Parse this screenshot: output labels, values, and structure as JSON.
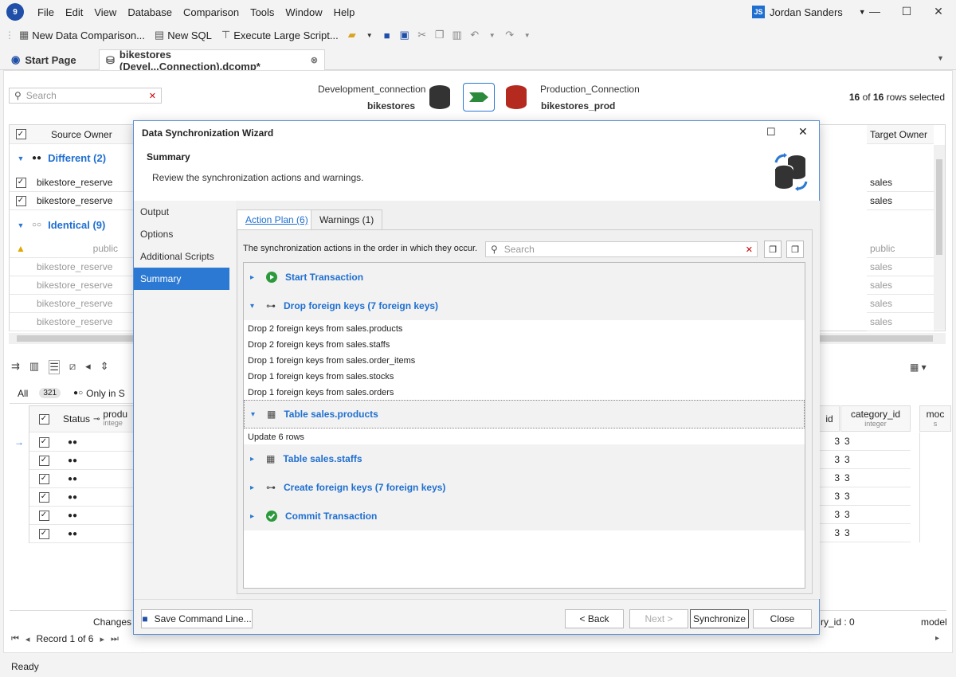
{
  "menu": [
    "File",
    "Edit",
    "View",
    "Database",
    "Comparison",
    "Tools",
    "Window",
    "Help"
  ],
  "user": {
    "initials": "JS",
    "name": "Jordan Sanders"
  },
  "toolbar": {
    "new_data_comparison": "New Data Comparison...",
    "new_sql": "New SQL",
    "execute_large_script": "Execute Large Script..."
  },
  "tabs": {
    "start_page": "Start Page",
    "document": "bikestores (Devel...Connection).dcomp*"
  },
  "main": {
    "search_placeholder": "Search",
    "source_conn_label": "Development_connection",
    "source_db": "bikestores",
    "target_conn_label": "Production_Connection",
    "target_db": "bikestores_prod",
    "rows_selected_a": "16",
    "rows_selected_of": "of",
    "rows_selected_b": "16",
    "rows_selected_suffix": "rows selected",
    "col_source_owner": "Source Owner",
    "col_target_owner": "Target Owner",
    "group_different": "Different (2)",
    "group_identical": "Identical (9)",
    "rows_left": [
      "bikestore_reserve",
      "bikestore_reserve",
      "public",
      "bikestore_reserve",
      "bikestore_reserve",
      "bikestore_reserve",
      "bikestore_reserve"
    ],
    "rows_right": [
      "sales",
      "sales",
      "public",
      "sales",
      "sales",
      "sales",
      "sales"
    ],
    "filter_all": "All",
    "filter_all_count": "321",
    "filter_only": "Only in S",
    "col_status": "Status",
    "col_product": "produ",
    "col_product_type": "intege",
    "col_id": "id",
    "col_category": "category_id",
    "col_category_type": "integer",
    "col_model": "moc",
    "col_model_type": "s",
    "category_values": [
      "3",
      "3",
      "3",
      "3",
      "3",
      "3"
    ],
    "changes_label": "Changes",
    "record_label": "Record 1 of 6",
    "category_footer": "ry_id : 0",
    "model_footer": "model"
  },
  "dialog": {
    "title": "Data Synchronization Wizard",
    "section": "Summary",
    "description": "Review the synchronization actions and warnings.",
    "nav": [
      "Output",
      "Options",
      "Additional Scripts",
      "Summary"
    ],
    "tab_action_plan": "Action Plan (6)",
    "tab_warnings": "Warnings (1)",
    "order_text": "The synchronization actions in the order in which they occur.",
    "search_placeholder": "Search",
    "actions": {
      "start": "Start Transaction",
      "drop_fk": "Drop foreign keys (7 foreign keys)",
      "drop_lines": [
        "Drop 2 foreign keys from sales.products",
        "Drop 2 foreign keys from sales.staffs",
        "Drop 1 foreign keys from sales.order_items",
        "Drop 1 foreign keys from sales.stocks",
        "Drop 1 foreign keys from sales.orders"
      ],
      "table_products": "Table sales.products",
      "update_rows": "Update 6 rows",
      "table_staffs": "Table sales.staffs",
      "create_fk": "Create foreign keys (7 foreign keys)",
      "commit": "Commit Transaction"
    },
    "buttons": {
      "save_cmd": "Save Command Line...",
      "back": "< Back",
      "next": "Next >",
      "synchronize": "Synchronize",
      "close": "Close"
    }
  },
  "status": "Ready"
}
